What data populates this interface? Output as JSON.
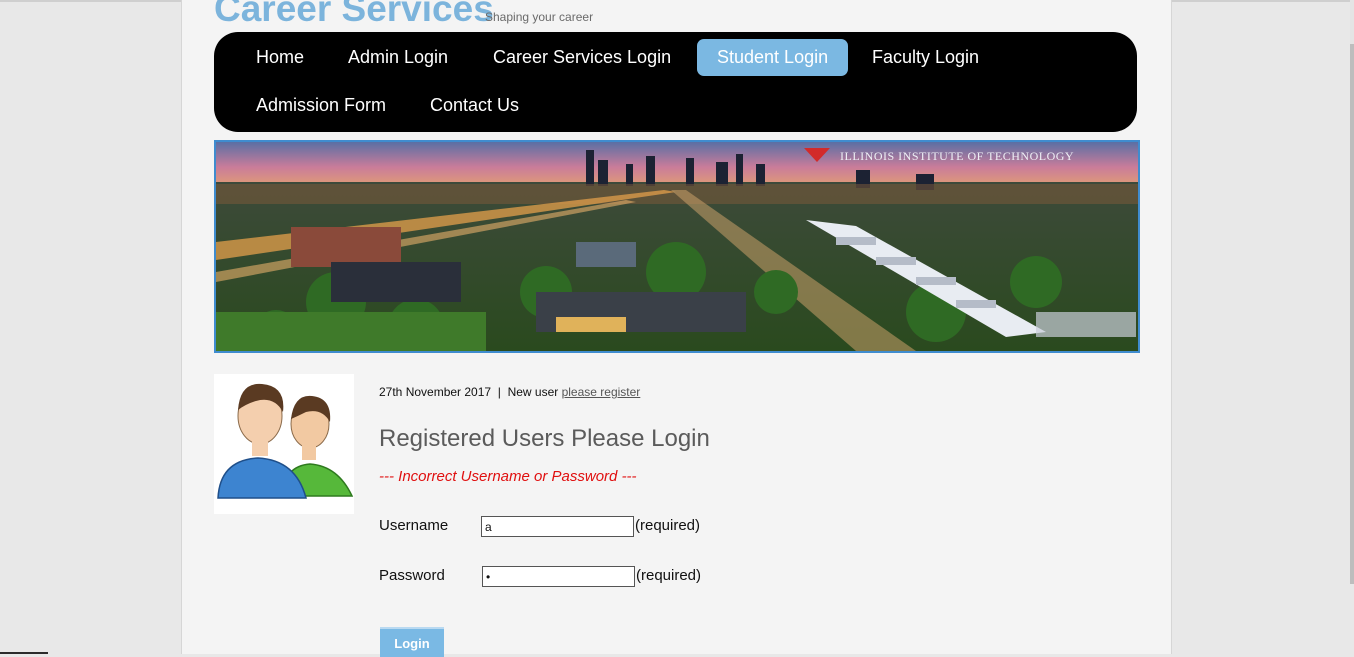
{
  "site": {
    "title": "Career Services",
    "tagline": "Shaping your career"
  },
  "nav": {
    "items": [
      {
        "label": "Home",
        "active": false
      },
      {
        "label": "Admin Login",
        "active": false
      },
      {
        "label": "Career Services Login",
        "active": false
      },
      {
        "label": "Student Login",
        "active": true
      },
      {
        "label": "Faculty Login",
        "active": false
      },
      {
        "label": "Admission Form",
        "active": false
      },
      {
        "label": "Contact Us",
        "active": false
      }
    ]
  },
  "banner": {
    "caption": "ILLINOIS INSTITUTE OF TECHNOLOGY"
  },
  "login": {
    "date": "27th November 2017",
    "separator": "|",
    "new_user_text": "New user",
    "register_link": "please register",
    "heading": "Registered Users Please Login",
    "error": "--- Incorrect Username or Password ---",
    "username_label": "Username",
    "username_value": "a",
    "username_note": "(required)",
    "password_label": "Password",
    "password_value": "a",
    "password_note": "(required)",
    "submit_label": "Login"
  },
  "colors": {
    "accent": "#7bb8e2",
    "error": "#e01010",
    "menubar": "#000000"
  }
}
